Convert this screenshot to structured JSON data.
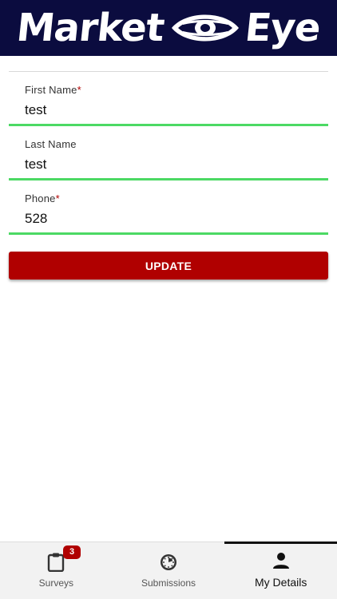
{
  "header": {
    "logo_left": "Market",
    "logo_right": "Eye",
    "background": "#0b0c3f"
  },
  "form": {
    "fields": [
      {
        "label": "First Name",
        "required": "*",
        "value": "test"
      },
      {
        "label": "Last Name",
        "required": "",
        "value": "test"
      },
      {
        "label": "Phone",
        "required": "*",
        "value": "528"
      }
    ],
    "underline_color": "#4cd964"
  },
  "update_button": {
    "label": "UPDATE",
    "color": "#b00000"
  },
  "bottom_nav": {
    "items": [
      {
        "label": "Surveys",
        "icon": "clipboard-icon",
        "badge": "3"
      },
      {
        "label": "Submissions",
        "icon": "clock-icon"
      },
      {
        "label": "My Details",
        "icon": "person-icon",
        "active": true
      }
    ]
  }
}
